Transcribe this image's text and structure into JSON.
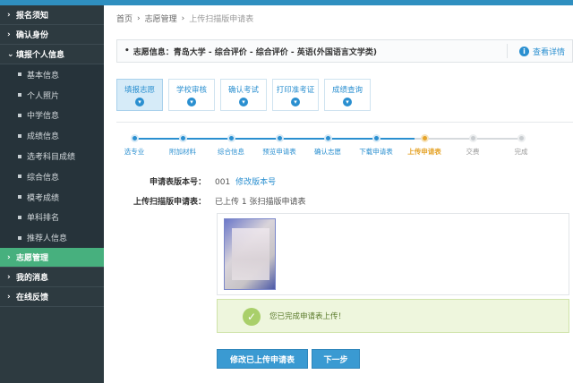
{
  "sidebar": {
    "items": [
      {
        "label": "报名须知",
        "type": "main"
      },
      {
        "label": "确认身份",
        "type": "main"
      },
      {
        "label": "填报个人信息",
        "type": "main"
      },
      {
        "label": "基本信息",
        "type": "sub"
      },
      {
        "label": "个人照片",
        "type": "sub"
      },
      {
        "label": "中学信息",
        "type": "sub"
      },
      {
        "label": "成绩信息",
        "type": "sub"
      },
      {
        "label": "选考科目成绩",
        "type": "sub"
      },
      {
        "label": "综合信息",
        "type": "sub"
      },
      {
        "label": "模考成绩",
        "type": "sub"
      },
      {
        "label": "单科排名",
        "type": "sub"
      },
      {
        "label": "推荐人信息",
        "type": "sub"
      },
      {
        "label": "志愿管理",
        "type": "main",
        "active": true
      },
      {
        "label": "我的消息",
        "type": "main"
      },
      {
        "label": "在线反馈",
        "type": "main"
      }
    ]
  },
  "breadcrumb": {
    "home": "首页",
    "section": "志愿管理",
    "current": "上传扫描版申请表"
  },
  "infobar": {
    "text": "志愿信息：青岛大学 - 综合评价 - 综合评价 - 英语(外国语言文学类)",
    "detail_link": "查看详情"
  },
  "tabs": [
    {
      "label": "填报志愿",
      "active": true
    },
    {
      "label": "学校审核",
      "active": false
    },
    {
      "label": "确认考试",
      "active": false
    },
    {
      "label": "打印准考证",
      "active": false
    },
    {
      "label": "成绩查询",
      "active": false
    }
  ],
  "steps": [
    {
      "label": "选专业",
      "state": "done"
    },
    {
      "label": "附加材料",
      "state": "done"
    },
    {
      "label": "综合信息",
      "state": "done"
    },
    {
      "label": "预览申请表",
      "state": "done"
    },
    {
      "label": "确认志愿",
      "state": "done"
    },
    {
      "label": "下载申请表",
      "state": "done"
    },
    {
      "label": "上传申请表",
      "state": "current"
    },
    {
      "label": "交费",
      "state": "todo"
    },
    {
      "label": "完成",
      "state": "todo"
    }
  ],
  "form": {
    "version_label": "申请表版本号：",
    "version_value": "001",
    "version_link": "修改版本号",
    "upload_label": "上传扫描版申请表：",
    "upload_value": "已上传 1 张扫描版申请表"
  },
  "success_message": "您已完成申请表上传！",
  "buttons": {
    "modify": "修改已上传申请表",
    "next": "下一步"
  },
  "colors": {
    "accent": "#2a8fd0",
    "sidebar_bg": "#2d3a40",
    "sidebar_active": "#47b07e",
    "current_step": "#e5a42b"
  }
}
